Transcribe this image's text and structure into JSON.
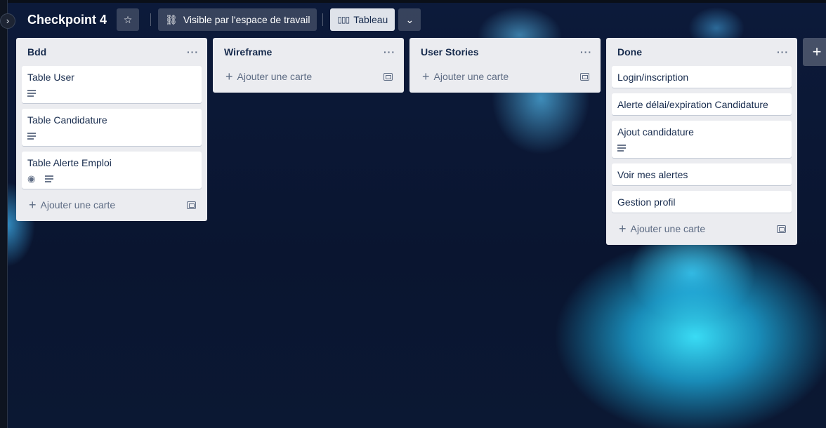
{
  "board": {
    "title": "Checkpoint 4",
    "visibility_label": "Visible par l'espace de travail",
    "view_label": "Tableau"
  },
  "lists": [
    {
      "title": "Bdd",
      "cards": [
        {
          "title": "Table User",
          "badges": [
            "description"
          ]
        },
        {
          "title": "Table Candidature",
          "badges": [
            "description"
          ]
        },
        {
          "title": "Table Alerte Emploi",
          "badges": [
            "watching",
            "description"
          ]
        }
      ],
      "add_label": "Ajouter une carte"
    },
    {
      "title": "Wireframe",
      "cards": [],
      "add_label": "Ajouter une carte"
    },
    {
      "title": "User Stories",
      "cards": [],
      "add_label": "Ajouter une carte"
    },
    {
      "title": "Done",
      "cards": [
        {
          "title": "Login/inscription",
          "badges": []
        },
        {
          "title": "Alerte délai/expiration Candidature",
          "badges": []
        },
        {
          "title": "Ajout candidature",
          "badges": [
            "description"
          ]
        },
        {
          "title": "Voir mes alertes",
          "badges": []
        },
        {
          "title": "Gestion profil",
          "badges": []
        }
      ],
      "add_label": "Ajouter une carte"
    }
  ],
  "icons": {
    "star": "star-icon",
    "visibility": "workspace-visibility-icon",
    "board_view": "board-view-icon",
    "chevron": "chevron-down-icon",
    "add_list": "plus-icon"
  }
}
